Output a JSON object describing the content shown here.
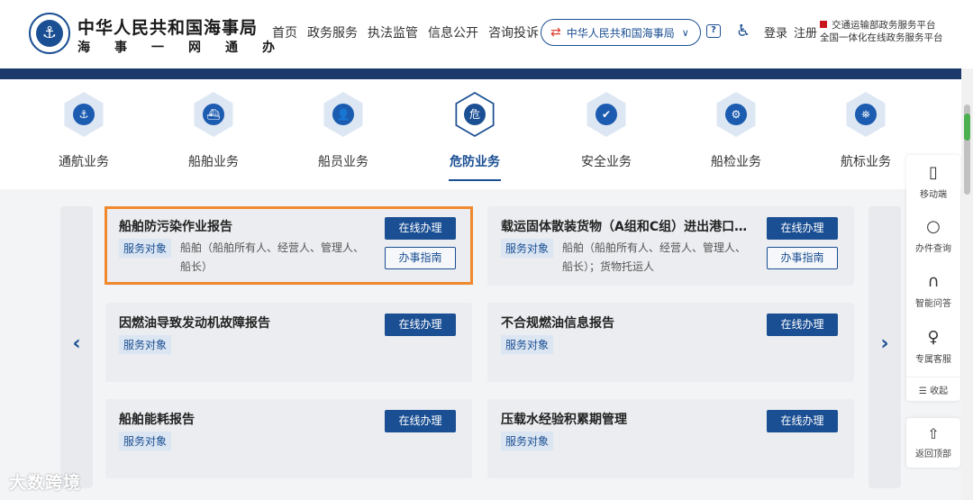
{
  "header": {
    "logo_icon": "anchor-emblem",
    "brand_title": "中华人民共和国海事局",
    "brand_sub": "海事一网通办",
    "nav": [
      "首页",
      "政务服务",
      "执法监管",
      "信息公开",
      "咨询投诉"
    ],
    "org_select": "中华人民共和国海事局",
    "login": "登录",
    "register": "注册",
    "platform_line1": "交通运输部政务服务平台",
    "platform_line2": "全国一体化在线政务服务平台"
  },
  "categories": [
    {
      "label": "通航业务",
      "icon": "⚓"
    },
    {
      "label": "船舶业务",
      "icon": "⛴"
    },
    {
      "label": "船员业务",
      "icon": "👤"
    },
    {
      "label": "危防业务",
      "icon": "危"
    },
    {
      "label": "安全业务",
      "icon": "✔"
    },
    {
      "label": "船检业务",
      "icon": "⚙"
    },
    {
      "label": "航标业务",
      "icon": "⛯"
    }
  ],
  "active_category": "危防业务",
  "cards": [
    {
      "title": "船舶防污染作业报告",
      "tag": "服务对象",
      "target": "船舶（船舶所有人、经营人、管理人、船长）",
      "btn_online": "在线办理",
      "btn_guide": "办事指南"
    },
    {
      "title": "载运固体散装货物（A组和C组）进出港口…",
      "tag": "服务对象",
      "target": "船舶（船舶所有人、经营人、管理人、船长）；货物托运人",
      "btn_online": "在线办理",
      "btn_guide": "办事指南"
    },
    {
      "title": "因燃油导致发动机故障报告",
      "tag": "服务对象",
      "target": "",
      "btn_online": "在线办理"
    },
    {
      "title": "不合规燃油信息报告",
      "tag": "服务对象",
      "target": "",
      "btn_online": "在线办理"
    },
    {
      "title": "船舶能耗报告",
      "tag": "服务对象",
      "target": "",
      "btn_online": "在线办理"
    },
    {
      "title": "压载水经验积累期管理",
      "tag": "服务对象",
      "target": "",
      "btn_online": "在线办理"
    }
  ],
  "side": {
    "mobile": "移动端",
    "query": "办件查询",
    "qa": "智能问答",
    "service": "专属客服",
    "collapse": "收起",
    "top": "返回顶部"
  },
  "watermark": "大数跨境",
  "colors": {
    "primary": "#1b4f93",
    "highlight": "#f0892e",
    "bar": "#1b3a6b"
  }
}
